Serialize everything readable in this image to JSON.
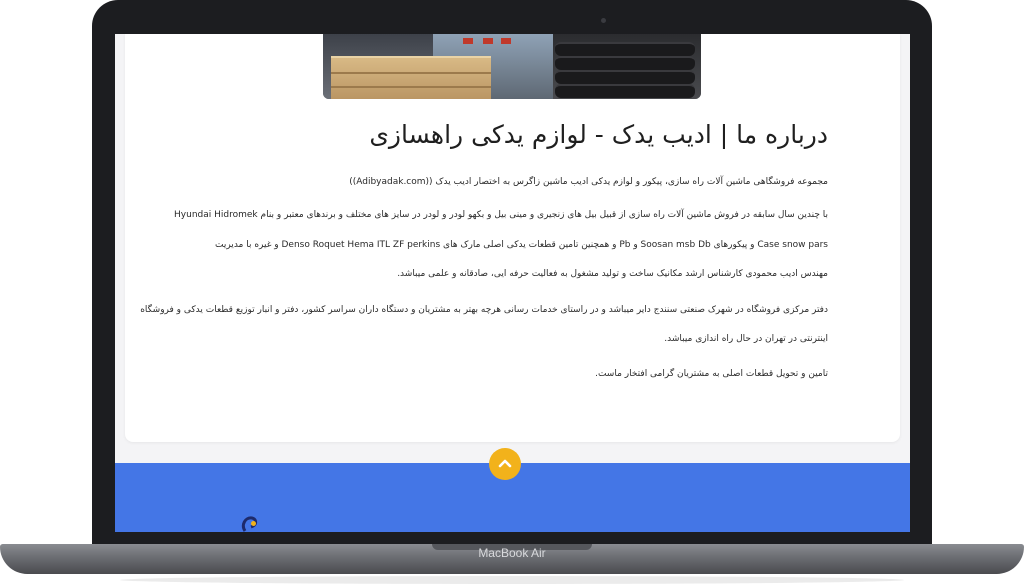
{
  "device": {
    "brand_label": "MacBook Air"
  },
  "page": {
    "title": "درباره ما | ادیب یدک - لوازم یدکی راهسازی",
    "paragraphs": [
      "مجموعه فروشگاهی ماشین آلات راه سازی،  پیکور و لوازم یدکی ادیب ماشین زاگرس  به اختصار ادیب یدک ((Adibyadak.com))",
      "با چندین سال سابقه در فروش ماشین آلات راه سازی از قبیل بیل های زنجیری و مینی بیل و بکهو لودر و لودر در سایز های مختلف و برندهای معتبر و بنام   Hyundai  Hidromek",
      "Case  snow pars و پیکورهای   Soosan  msb  Db  و Pb و همچنین تامین قطعات یدکی اصلی مارک های  Denso  Roquet    Hema   ITL   ZF   perkins   و غیره با مدیریت",
      "مهندس ادیب محمودی کارشناس ارشد مکانیک ساخت و تولید  مشغول به فعالیت حرفه ایی، صادقانه و علمی میباشد.",
      "دفتر مرکزی فروشگاه در شهرک صنعتی سنندج دایر میباشد و در راستای خدمات رسانی هرچه بهتر به مشتریان و دستگاه داران سراسر کشور، دفتر و انبار توزیع قطعات یدکی و فروشگاه",
      "اینترنتی در  تهران در حال راه اندازی میباشد.",
      "تامین و تحویل قطعات اصلی به مشتریان گرامی افتخار ماست."
    ]
  },
  "footer": {
    "scroll_top_icon": "chevron-up-icon",
    "color": "#4476e6",
    "accent": "#f2b21b"
  }
}
